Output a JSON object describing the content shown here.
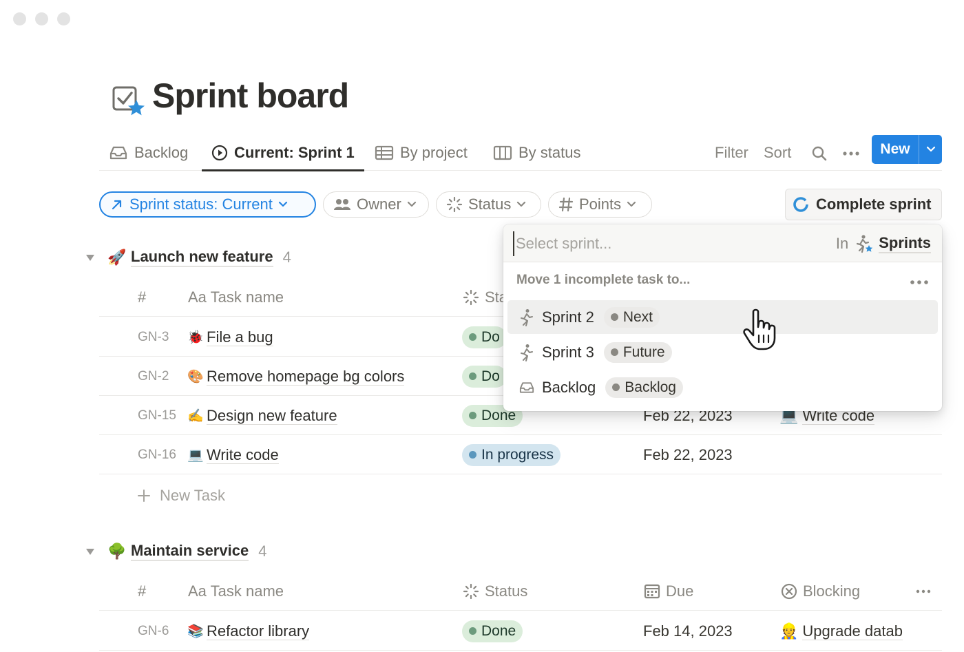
{
  "page": {
    "title": "Sprint board"
  },
  "tabs": [
    {
      "label": "Backlog",
      "icon": "inbox-icon"
    },
    {
      "label": "Current: Sprint 1",
      "icon": "play-circle-icon",
      "active": true
    },
    {
      "label": "By project",
      "icon": "table-icon"
    },
    {
      "label": "By status",
      "icon": "board-columns-icon"
    }
  ],
  "toolbar": {
    "filter": "Filter",
    "sort": "Sort",
    "new": "New"
  },
  "filters": {
    "sprint_status": "Sprint status: Current",
    "owner": "Owner",
    "status": "Status",
    "points": "Points"
  },
  "complete_sprint": "Complete sprint",
  "columns": {
    "id": "#",
    "name": "Aa Task name",
    "status": "Status",
    "due": "Due",
    "blocking": "Blocking"
  },
  "groups": [
    {
      "title": "Launch new feature",
      "emoji": "🚀",
      "count": "4",
      "status_header_visible": "Sta",
      "rows": [
        {
          "id": "GN-3",
          "emoji": "🐞",
          "name": "File a bug",
          "status": "Do",
          "status_type": "done",
          "due": "",
          "blocking": ""
        },
        {
          "id": "GN-2",
          "emoji": "🎨",
          "name": "Remove homepage bg colors",
          "status": "Do",
          "status_type": "done",
          "due": "",
          "blocking": ""
        },
        {
          "id": "GN-15",
          "emoji": "✍️",
          "name": "Design new feature",
          "status": "Done",
          "status_type": "done",
          "due": "Feb 22, 2023",
          "blocking_emoji": "💻",
          "blocking": "Write code"
        },
        {
          "id": "GN-16",
          "emoji": "💻",
          "name": "Write code",
          "status": "In progress",
          "status_type": "progress",
          "due": "Feb 22, 2023",
          "blocking": ""
        }
      ],
      "new_task": "New Task"
    },
    {
      "title": "Maintain service",
      "emoji": "🌳",
      "count": "4",
      "rows": [
        {
          "id": "GN-6",
          "emoji": "📚",
          "name": "Refactor library",
          "status": "Done",
          "status_type": "done",
          "due": "Feb 14, 2023",
          "blocking_emoji": "👷",
          "blocking": "Upgrade datab"
        }
      ]
    }
  ],
  "dropdown": {
    "placeholder": "Select sprint...",
    "in_label": "In",
    "source": "Sprints",
    "section": "Move 1 incomplete task to...",
    "options": [
      {
        "label": "Sprint 2",
        "tag": "Next",
        "icon": "runner-icon"
      },
      {
        "label": "Sprint 3",
        "tag": "Future",
        "icon": "runner-icon"
      },
      {
        "label": "Backlog",
        "tag": "Backlog",
        "icon": "inbox-icon"
      }
    ]
  },
  "colors": {
    "accent": "#2383e2",
    "done_bg": "#dbeddb",
    "progress_bg": "#d3e5ef"
  }
}
